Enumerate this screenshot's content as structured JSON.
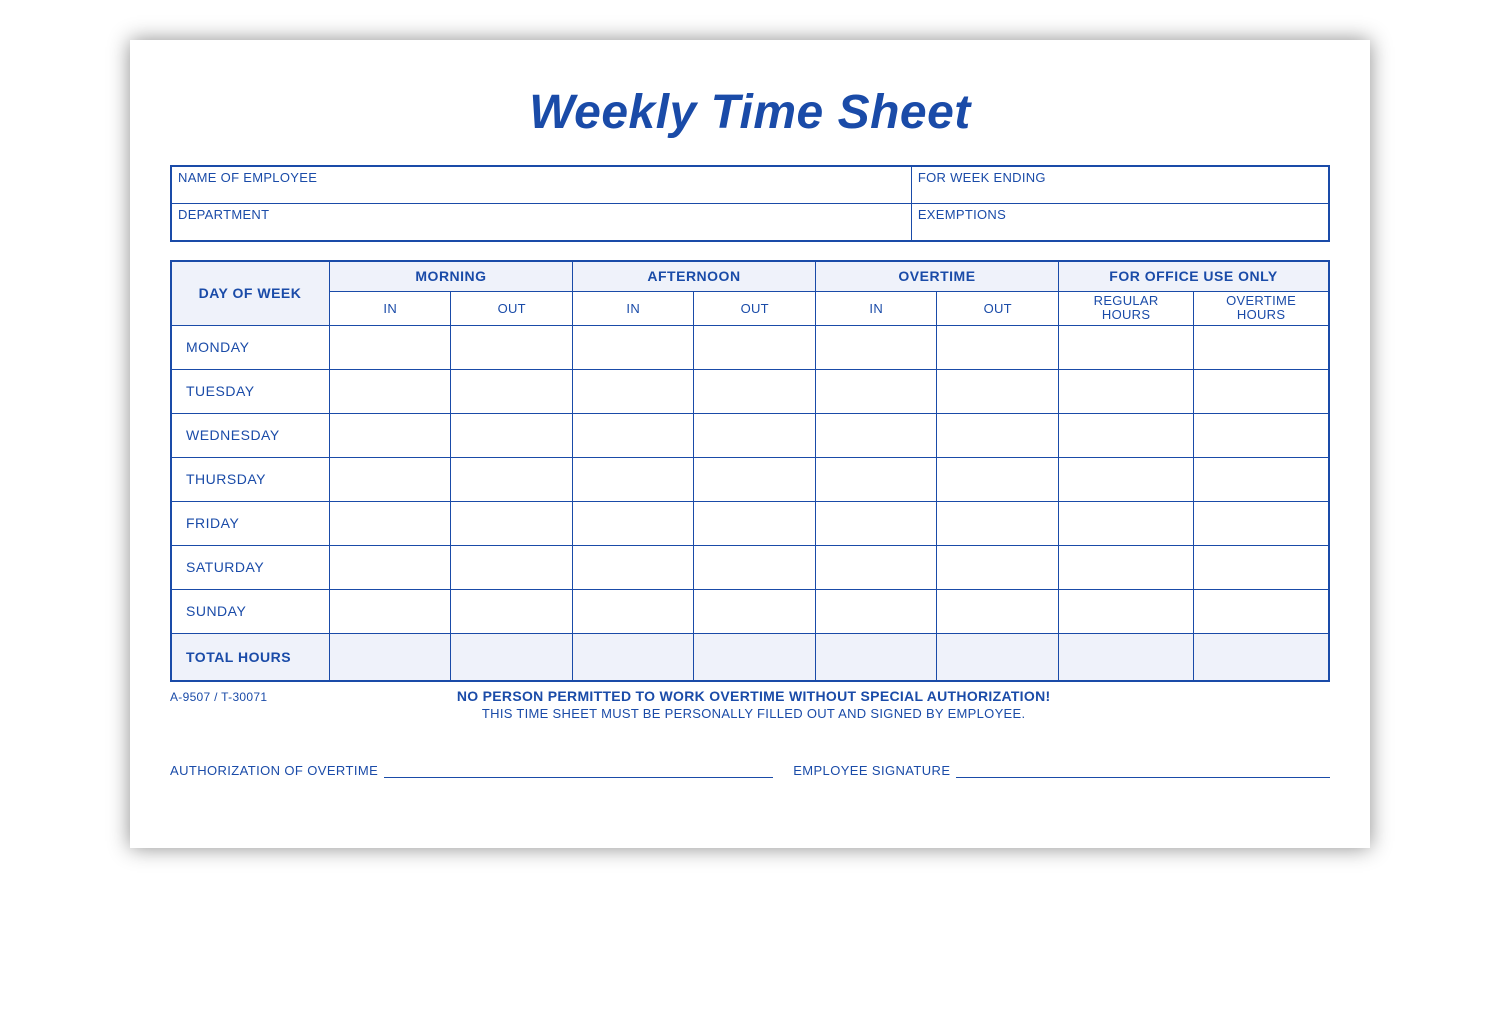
{
  "title": "Weekly Time Sheet",
  "info": {
    "name_label": "NAME OF EMPLOYEE",
    "week_label": "FOR WEEK ENDING",
    "dept_label": "DEPARTMENT",
    "exempt_label": "EXEMPTIONS"
  },
  "headers": {
    "day": "DAY OF WEEK",
    "morning": "MORNING",
    "afternoon": "AFTERNOON",
    "overtime": "OVERTIME",
    "office": "FOR OFFICE USE ONLY",
    "in": "IN",
    "out": "OUT",
    "regular_hours": "REGULAR HOURS",
    "overtime_hours": "OVERTIME HOURS"
  },
  "days": [
    "MONDAY",
    "TUESDAY",
    "WEDNESDAY",
    "THURSDAY",
    "FRIDAY",
    "SATURDAY",
    "SUNDAY"
  ],
  "total_label": "TOTAL HOURS",
  "form_code": "A-9507 / T-30071",
  "footer": {
    "warn": "NO PERSON PERMITTED TO WORK OVERTIME WITHOUT SPECIAL AUTHORIZATION!",
    "note": "THIS TIME SHEET MUST BE PERSONALLY FILLED OUT AND SIGNED BY EMPLOYEE."
  },
  "sign": {
    "auth_label": "AUTHORIZATION OF OVERTIME",
    "sig_label": "EMPLOYEE SIGNATURE"
  }
}
